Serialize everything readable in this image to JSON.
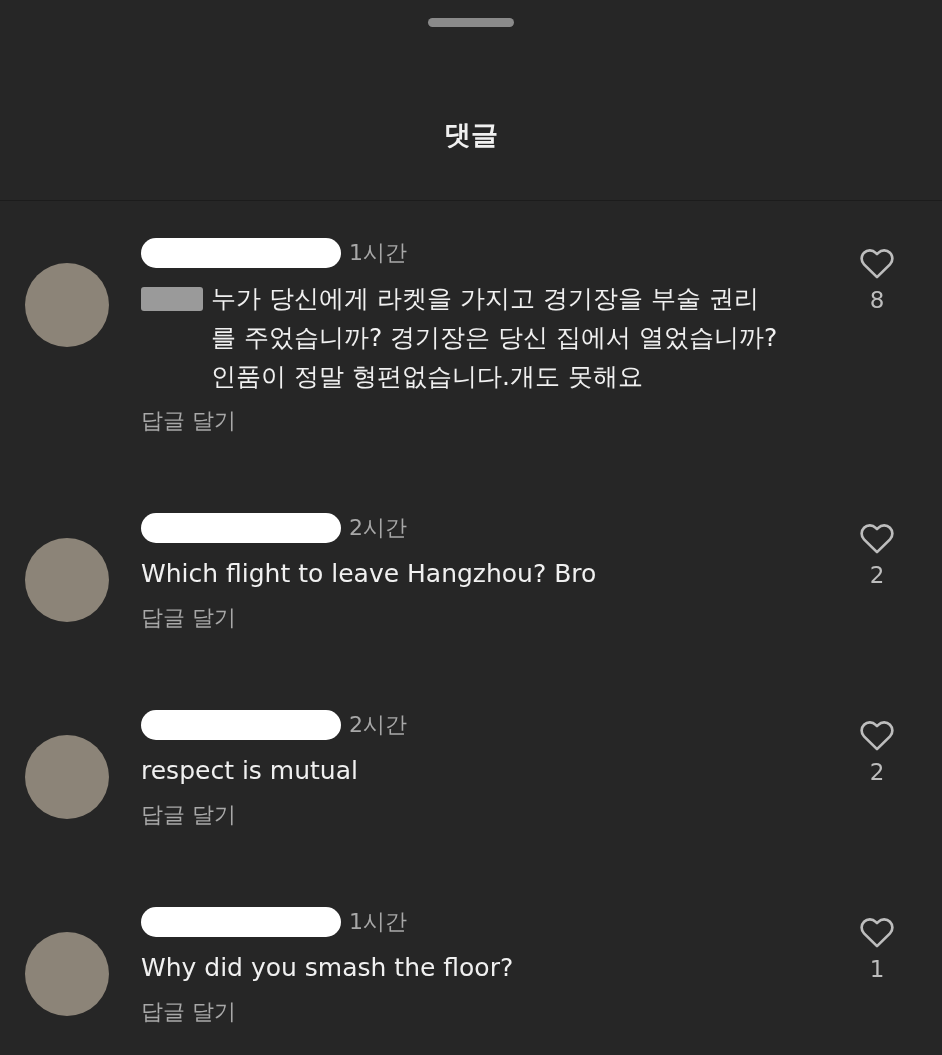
{
  "sheet": {
    "title": "댓글"
  },
  "comments": [
    {
      "time": "1시간",
      "mention_hidden": true,
      "text": "누가 당신에게 라켓을 가지고 경기장을 부술 권리를 주었습니까? 경기장은 당신 집에서 열었습니까? 인품이 정말 형편없습니다.개도 못해요",
      "reply": "답글 달기",
      "likes": "8"
    },
    {
      "time": "2시간",
      "mention_hidden": false,
      "text": "Which flight to leave Hangzhou? Bro",
      "reply": "답글 달기",
      "likes": "2"
    },
    {
      "time": "2시간",
      "mention_hidden": false,
      "text": "respect is mutual",
      "reply": "답글 달기",
      "likes": "2"
    },
    {
      "time": "1시간",
      "mention_hidden": false,
      "text": "Why did you smash the floor?",
      "reply": "답글 달기",
      "likes": "1"
    }
  ]
}
